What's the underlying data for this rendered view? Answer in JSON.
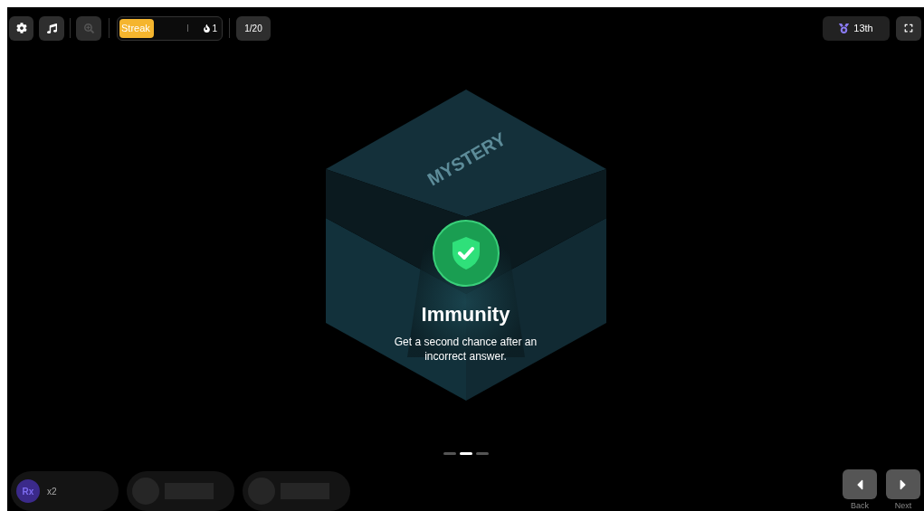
{
  "toolbar": {
    "streak": {
      "label": "Streak",
      "level": 0.34,
      "count": "1"
    },
    "progress": "1/20",
    "rank": "13th"
  },
  "card": {
    "box_label": "MYSTERY",
    "title": "Immunity",
    "description": "Get a second chance after an incorrect answer."
  },
  "pager": [
    {
      "selected": false
    },
    {
      "selected": true
    },
    {
      "selected": false
    }
  ],
  "powerups": [
    {
      "kind": "active",
      "icon": "Rx",
      "count": "x2"
    },
    {
      "kind": "empty"
    },
    {
      "kind": "empty"
    }
  ],
  "nav": {
    "back": "Back",
    "next": "Next"
  }
}
